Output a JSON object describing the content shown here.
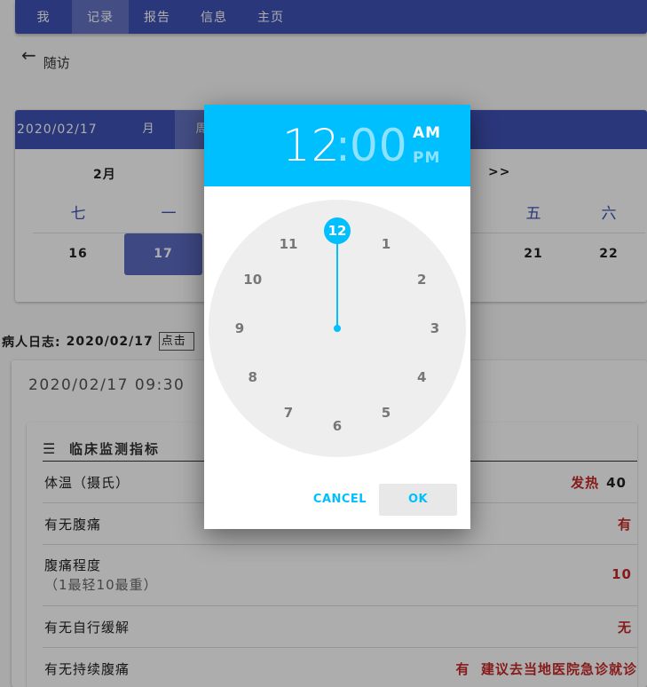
{
  "topnav": [
    "我",
    "记录",
    "报告",
    "信息",
    "主页"
  ],
  "back_label": "随访",
  "calendar": {
    "date": "2020/02/17",
    "modes": [
      "月",
      "周"
    ],
    "month": "2月",
    "next": ">>",
    "weekdays": [
      "七",
      "一",
      "五",
      "六"
    ],
    "days": [
      "16",
      "17",
      "21",
      "22"
    ]
  },
  "log": {
    "label": "病人日志:",
    "date": "2020/02/17",
    "button": "点击"
  },
  "record": {
    "time": "2020/02/17 09:30",
    "section_title": "临床监测指标",
    "rows": [
      {
        "name": "体温（摄氏）",
        "value": "发热",
        "number": "40"
      },
      {
        "name": "有无腹痛",
        "value": "有"
      },
      {
        "name": "腹痛程度",
        "sub": "（1最轻10最重）",
        "value": "10"
      },
      {
        "name": "有无自行缓解",
        "value": "无"
      },
      {
        "name": "有无持续腹痛",
        "value": "有  建议去当地医院急诊就诊"
      }
    ]
  },
  "timepicker": {
    "hour": "12",
    "colon": ":",
    "minute": "00",
    "am": "AM",
    "pm": "PM",
    "hours": [
      "12",
      "1",
      "2",
      "3",
      "4",
      "5",
      "6",
      "7",
      "8",
      "9",
      "10",
      "11"
    ],
    "selected_hour": "12",
    "cancel": "CANCEL",
    "ok": "OK"
  },
  "colors": {
    "primary": "#3f51b5",
    "accent": "#00bfff",
    "alert": "#c62828"
  }
}
